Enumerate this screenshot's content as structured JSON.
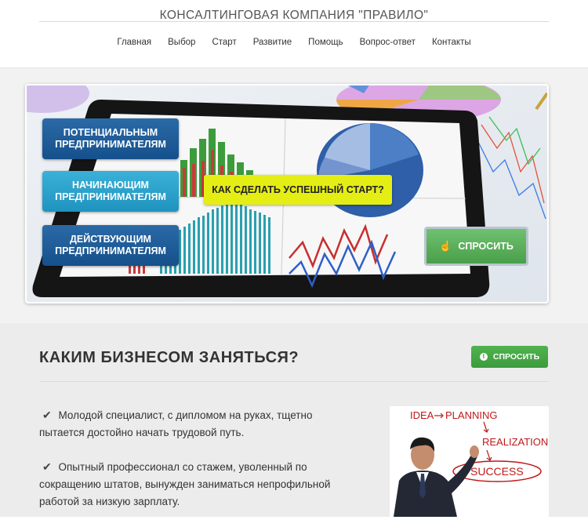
{
  "site": {
    "title": "КОНСАЛТИНГОВАЯ КОМПАНИЯ \"ПРАВИЛО\""
  },
  "nav": {
    "items": [
      "Главная",
      "Выбор",
      "Старт",
      "Развитие",
      "Помощь",
      "Вопрос-ответ",
      "Контакты"
    ]
  },
  "hero": {
    "audience_buttons": [
      {
        "line1": "ПОТЕНЦИАЛЬНЫМ",
        "line2": "ПРЕДПРИНИМАТЕЛЯМ"
      },
      {
        "line1": "НАЧИНАЮЩИМ",
        "line2": "ПРЕДПРИНИМАТЕЛЯМ"
      },
      {
        "line1": "ДЕЙСТВУЮЩИМ",
        "line2": "ПРЕДПРИНИМАТЕЛЯМ"
      }
    ],
    "start_button": "КАК СДЕЛАТЬ УСПЕШНЫЙ СТАРТ?",
    "ask_button": "СПРОСИТЬ"
  },
  "section": {
    "title": "КАКИМ БИЗНЕСОМ ЗАНЯТЬСЯ?",
    "ask_button": "СПРОСИТЬ",
    "bullets": [
      "Молодой специалист, с дипломом на руках, тщетно пытается достойно начать трудовой путь.",
      "Опытный профессионал со стажем, уволенный по сокращению штатов, вынужден заниматься непрофильной работой за низкую зарплату."
    ],
    "photo_words": [
      "IDEA",
      "PLANNING",
      "REALIZATION",
      "SUCCESS"
    ]
  },
  "colors": {
    "brand_blue": "#15508b",
    "light_blue": "#1f93bf",
    "accent_yellow": "#e4ee14",
    "action_green": "#4a9f4a"
  }
}
